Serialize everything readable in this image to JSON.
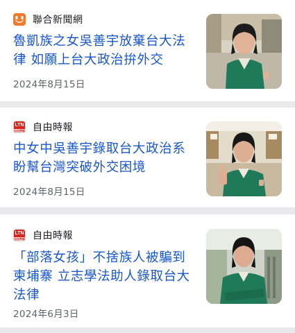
{
  "articles": [
    {
      "source": "聯合新聞網",
      "source_logo_icon": "udn-logo-icon",
      "headline": "魯凱族之女吳善宇放棄台大法律 如願上台大政治拚外交",
      "date": "2024年8月15日"
    },
    {
      "source": "自由時報",
      "source_logo_icon": "ltn-logo-icon",
      "headline": "中女中吳善宇錄取台大政治系 盼幫台灣突破外交困境",
      "date": "2024年8月15日"
    },
    {
      "source": "自由時報",
      "source_logo_icon": "ltn-logo-icon",
      "headline": "「部落女孩」不捨族人被騙到柬埔寨 立志學法助人錄取台大法律",
      "date": "2024年6月3日"
    }
  ],
  "ltn_logo": {
    "top": "LTN",
    "bottom": "自由時報"
  },
  "colors": {
    "headline": "#1a57c9",
    "date": "#5f6368",
    "background": "#e9e9ec",
    "udn_brand": "#f0792b",
    "ltn_brand": "#d7261e"
  }
}
